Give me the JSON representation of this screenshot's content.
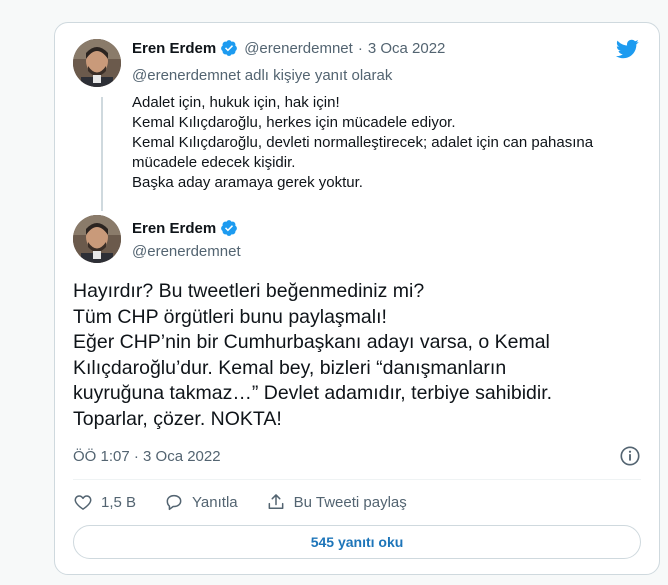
{
  "colors": {
    "accent": "#1d9bf0",
    "link": "#1d75b9",
    "text": "#0f1419",
    "muted": "#536471",
    "border": "#cfd9de"
  },
  "reply_tweet": {
    "author_name": "Eren Erdem",
    "handle": "@erenerdemnet",
    "separator": "·",
    "date": "3 Oca 2022",
    "replying_to": "@erenerdemnet adlı kişiye yanıt olarak",
    "lines": [
      "Adalet için, hukuk için, hak için!",
      "Kemal Kılıçdaroğlu, herkes için mücadele ediyor.",
      "Kemal Kılıçdaroğlu, devleti normalleştirecek; adalet için can pahasına",
      "mücadele edecek kişidir.",
      "Başka aday aramaya gerek yoktur."
    ]
  },
  "main_tweet": {
    "author_name": "Eren Erdem",
    "handle": "@erenerdemnet",
    "lines": [
      "Hayırdır? Bu tweetleri beğenmediniz mi?",
      "Tüm CHP örgütleri bunu paylaşmalı!",
      "Eğer CHP’nin bir Cumhurbaşkanı adayı varsa, o Kemal",
      "Kılıçdaroğlu’dur. Kemal bey, bizleri “danışmanların",
      "kuyruğuna takmaz…” Devlet adamıdır, terbiye sahibidir.",
      "Toparlar, çözer. NOKTA!"
    ],
    "timestamp": "ÖÖ 1:07 · 3 Oca 2022"
  },
  "actions": {
    "like_count": "1,5 B",
    "reply_label": "Yanıtla",
    "share_label": "Bu Tweeti paylaş"
  },
  "read_replies_label": "545 yanıtı oku",
  "icons": {
    "brand": "twitter-bird-icon",
    "verified": "verified-badge-icon",
    "info": "info-icon",
    "like": "heart-icon",
    "reply": "speech-bubble-icon",
    "share": "share-upload-icon"
  }
}
